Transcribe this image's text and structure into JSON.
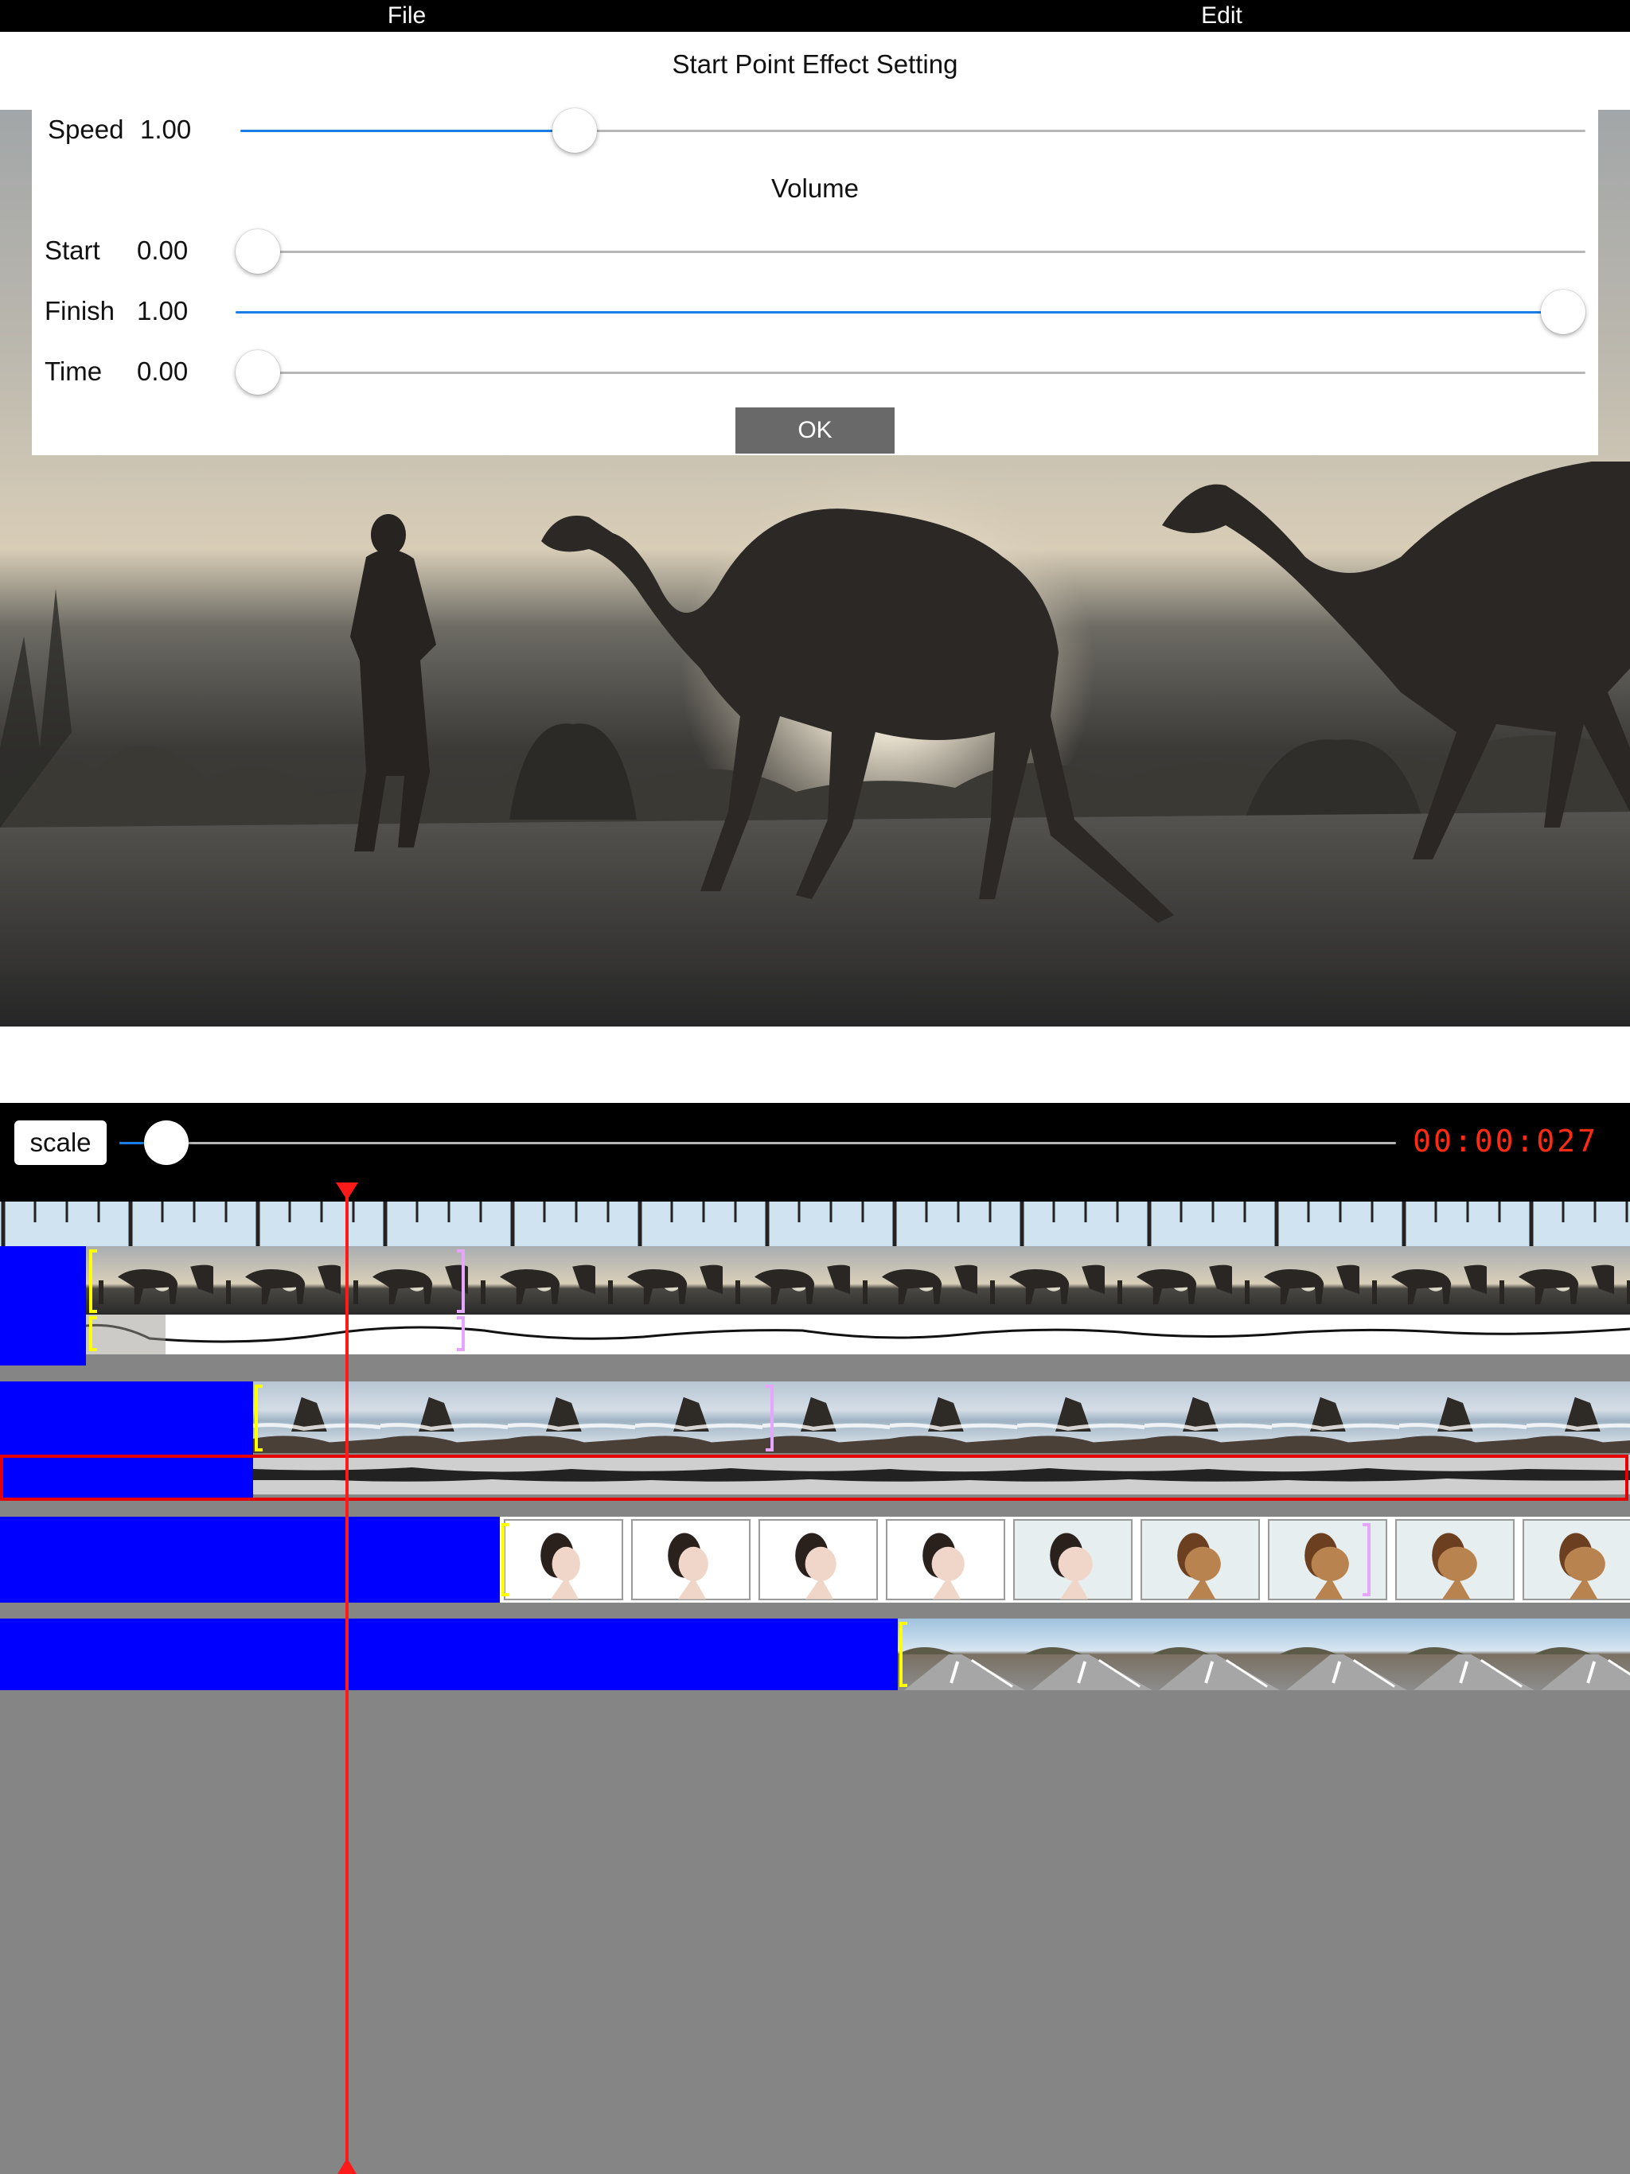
{
  "menu": {
    "file_label": "File",
    "edit_label": "Edit"
  },
  "dialog": {
    "title": "Start Point Effect Setting",
    "speed": {
      "label": "Speed",
      "value": "1.00",
      "position": 0.24
    },
    "volume_heading": "Volume",
    "start": {
      "label": "Start",
      "value": "0.00",
      "position": 0.0
    },
    "finish": {
      "label": "Finish",
      "value": "1.00",
      "position": 1.0
    },
    "time": {
      "label": "Time",
      "value": "0.00",
      "position": 0.0
    },
    "ok_label": "OK"
  },
  "timeline": {
    "scale_label": "scale",
    "scale_position": 0.02,
    "timecode": "00:00:027",
    "clips": [
      "camel-walk",
      "sea-rocks",
      "woman-to-dog-morph",
      "road"
    ]
  },
  "colors": {
    "accent": "#1a7ee6",
    "timecode": "#ff2a12",
    "clip_offset": "#0000ff",
    "playhead": "#ff1a1a",
    "in_marker": "#ffff00",
    "out_marker": "#e6a5ff",
    "selection": "#e60000"
  }
}
